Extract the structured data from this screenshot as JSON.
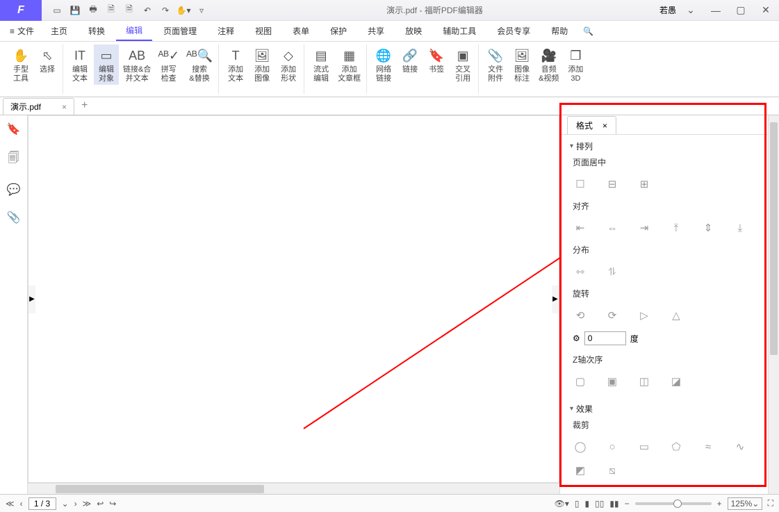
{
  "app": {
    "logo": "F",
    "title_doc": "演示.pdf",
    "title_app": "福昕PDF编辑器",
    "user": "若愚"
  },
  "menu": {
    "file": "文件",
    "items": [
      "主页",
      "转换",
      "编辑",
      "页面管理",
      "注释",
      "视图",
      "表单",
      "保护",
      "共享",
      "放映",
      "辅助工具",
      "会员专享",
      "帮助"
    ],
    "active": 2
  },
  "ribbon": {
    "hand": "手型\n工具",
    "select": "选择",
    "edit_text": "编辑\n文本",
    "edit_obj": "编辑\n对象",
    "link_merge": "链接&合\n并文本",
    "spell": "拼写\n检查",
    "search": "搜索\n&替换",
    "add_text": "添加\n文本",
    "add_image": "添加\n图像",
    "add_shape": "添加\n形状",
    "flow_edit": "流式\n编辑",
    "add_article": "添加\n文章框",
    "web_link": "网络\n链接",
    "link": "链接",
    "bookmark": "书签",
    "crossref": "交叉\n引用",
    "attach": "文件\n附件",
    "imgmark": "图像\n标注",
    "av": "音频\n&视频",
    "add3d": "添加\n3D"
  },
  "docTab": {
    "name": "演示.pdf"
  },
  "panel": {
    "tab": "格式",
    "sect_arrange": "排列",
    "sub_pagecenter": "页面居中",
    "sub_align": "对齐",
    "sub_dist": "分布",
    "sub_rotate": "旋转",
    "rotate_val": "0",
    "rotate_unit": "度",
    "sub_zorder": "Z轴次序",
    "sect_effect": "效果",
    "sub_crop": "裁剪"
  },
  "status": {
    "page": "1 / 3",
    "zoom": "125%"
  }
}
